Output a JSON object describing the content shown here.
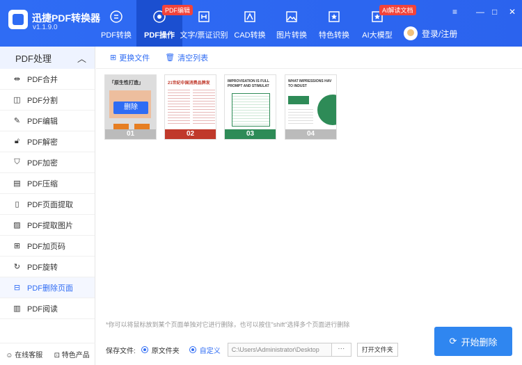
{
  "app": {
    "name": "迅捷PDF转换器",
    "version": "v1.1.9.0"
  },
  "nav": {
    "tabs": [
      {
        "label": "PDF转换"
      },
      {
        "label": "PDF操作",
        "badge": "PDF编辑"
      },
      {
        "label": "文字/票证识别"
      },
      {
        "label": "CAD转换"
      },
      {
        "label": "图片转换"
      },
      {
        "label": "特色转换"
      },
      {
        "label": "AI大模型",
        "badge": "AI解读文档"
      }
    ],
    "user_label": "登录/注册"
  },
  "window": {
    "menu": "≡",
    "minimize": "—",
    "maximize": "□",
    "close": "✕"
  },
  "sidebar": {
    "header": "PDF处理",
    "items": [
      {
        "label": "PDF合并"
      },
      {
        "label": "PDF分割"
      },
      {
        "label": "PDF编辑"
      },
      {
        "label": "PDF解密"
      },
      {
        "label": "PDF加密"
      },
      {
        "label": "PDF压缩"
      },
      {
        "label": "PDF页面提取"
      },
      {
        "label": "PDF提取图片"
      },
      {
        "label": "PDF加页码"
      },
      {
        "label": "PDF旋转"
      },
      {
        "label": "PDF删除页面"
      },
      {
        "label": "PDF阅读"
      }
    ],
    "footer_service": "在线客服",
    "footer_products": "特色产品"
  },
  "toolbar": {
    "replace_file": "更换文件",
    "clear_list": "清空列表"
  },
  "pages": [
    {
      "num": "01",
      "delete_label": "删除",
      "title": "「原生性打造」"
    },
    {
      "num": "02",
      "title": "21世纪中国消费品牌发"
    },
    {
      "num": "03",
      "title": "IMPROVISATION IS FULL PROMPT AND STIMULAT"
    },
    {
      "num": "04",
      "title": "WHAT IMPRESSIONS HAV TO INDUST"
    }
  ],
  "hint": "*你可以将鼠标放到某个页面单独对它进行删除，也可以按住\"shift\"选择多个页面进行删除",
  "save": {
    "label": "保存文件:",
    "option_source": "原文件夹",
    "option_custom": "自定义",
    "path": "C:\\Users\\Administrator\\Desktop",
    "browse": "···",
    "open_folder": "打开文件夹"
  },
  "start_button": "开始删除"
}
